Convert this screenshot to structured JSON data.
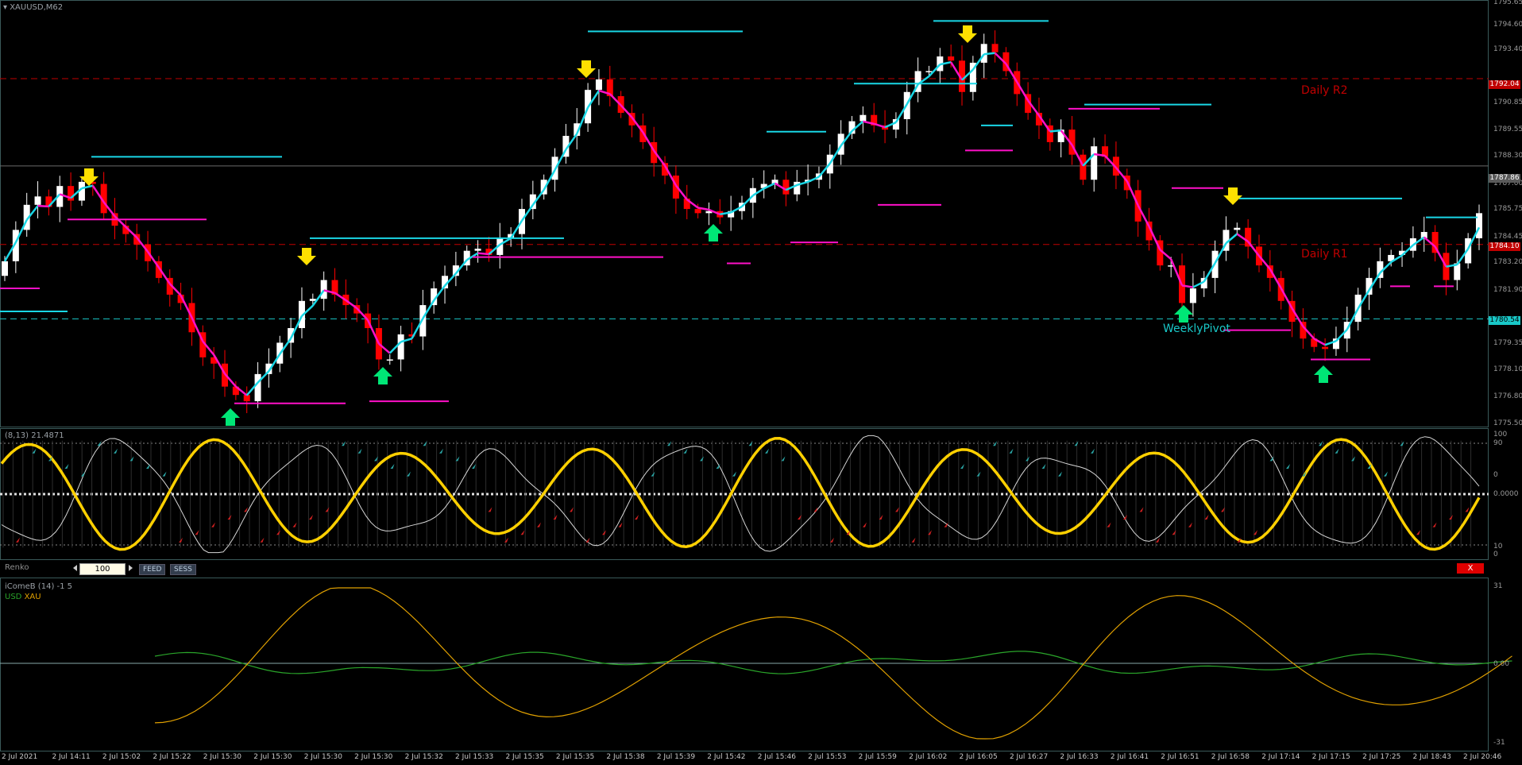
{
  "chart_window": {
    "symbol_label": "XAUUSD,M62",
    "stoch_label": "(8,13) 21.4871",
    "renko_panel": {
      "title": "Renko",
      "brick_value": "100",
      "feed_label": "FEED",
      "sess_label": "SESS",
      "close_label": "X"
    },
    "icome_label": "iComeB (14)  -1 5",
    "usd_label": "USD",
    "xau_label": "XAU",
    "colors": {
      "bull": "#ffffff",
      "bear": "#ff0000",
      "up_line": "#19d7e6",
      "down_line": "#ff10c8",
      "daily_level": "#c00000",
      "pivot": "#19c8c8",
      "stoch_main": "#ffd000",
      "usd_line": "#2aa52a",
      "xau_line": "#e0a000"
    }
  },
  "price_axis": [
    "1795.65",
    "1794.60",
    "1793.40",
    "1790.85",
    "1789.55",
    "1788.30",
    "1787.00",
    "1785.75",
    "1784.45",
    "1783.20",
    "1781.90",
    "1779.35",
    "1778.10",
    "1776.80",
    "1775.50"
  ],
  "price_badges": {
    "daily_r2": "1792.04",
    "current": "1787.86",
    "daily_r1": "1784.10",
    "pivot": "1780.54"
  },
  "level_labels": {
    "daily_r2": "Daily R2",
    "daily_r1": "Daily R1",
    "weekly_pivot": "WeeklyPivot"
  },
  "stoch_axis": [
    "100",
    "90",
    "0",
    "10",
    "0"
  ],
  "stoch_mid_label": "0.0000",
  "icome_axis": [
    "31",
    "0.00",
    "-31"
  ],
  "time_axis": [
    "2 Jul 2021",
    "2 Jul 14:11",
    "2 Jul 15:02",
    "2 Jul 15:22",
    "2 Jul 15:30",
    "2 Jul 15:30",
    "2 Jul 15:30",
    "2 Jul 15:30",
    "2 Jul 15:32",
    "2 Jul 15:33",
    "2 Jul 15:35",
    "2 Jul 15:35",
    "2 Jul 15:38",
    "2 Jul 15:39",
    "2 Jul 15:42",
    "2 Jul 15:46",
    "2 Jul 15:53",
    "2 Jul 15:59",
    "2 Jul 16:02",
    "2 Jul 16:05",
    "2 Jul 16:27",
    "2 Jul 16:33",
    "2 Jul 16:41",
    "2 Jul 16:51",
    "2 Jul 16:58",
    "2 Jul 17:14",
    "2 Jul 17:15",
    "2 Jul 17:25",
    "2 Jul 18:43",
    "2 Jul 20:46"
  ],
  "chart_data": {
    "type": "candlestick",
    "price_range": [
      1775.5,
      1795.65
    ],
    "closes": [
      1783.3,
      1784.8,
      1786.0,
      1786.4,
      1785.9,
      1786.9,
      1786.2,
      1787.1,
      1787.0,
      1785.6,
      1785.0,
      1784.6,
      1784.1,
      1783.3,
      1782.5,
      1781.7,
      1781.3,
      1779.9,
      1778.7,
      1778.4,
      1777.3,
      1776.9,
      1776.6,
      1777.9,
      1778.4,
      1779.4,
      1780.1,
      1781.4,
      1781.5,
      1782.4,
      1781.7,
      1781.2,
      1780.8,
      1780.1,
      1778.6,
      1778.6,
      1779.8,
      1779.7,
      1781.2,
      1782.0,
      1782.6,
      1783.1,
      1783.8,
      1783.9,
      1783.6,
      1784.4,
      1784.6,
      1785.8,
      1786.5,
      1787.2,
      1788.3,
      1789.3,
      1789.9,
      1791.5,
      1792.0,
      1791.2,
      1790.4,
      1789.8,
      1789.0,
      1788.0,
      1787.4,
      1786.3,
      1785.8,
      1785.6,
      1785.7,
      1785.4,
      1785.7,
      1786.1,
      1786.8,
      1787.0,
      1787.2,
      1786.5,
      1787.1,
      1787.2,
      1787.5,
      1788.4,
      1789.4,
      1790.0,
      1790.3,
      1789.8,
      1789.6,
      1790.1,
      1791.4,
      1792.4,
      1792.4,
      1793.1,
      1792.9,
      1791.4,
      1792.8,
      1793.7,
      1793.3,
      1792.4,
      1791.3,
      1790.4,
      1789.8,
      1789.0,
      1789.6,
      1788.4,
      1787.2,
      1788.8,
      1788.3,
      1787.4,
      1786.7,
      1785.2,
      1784.3,
      1783.1,
      1783.1,
      1781.3,
      1782.0,
      1782.5,
      1783.8,
      1784.8,
      1784.9,
      1784.0,
      1783.1,
      1782.5,
      1781.4,
      1780.4,
      1779.6,
      1779.2,
      1779.1,
      1779.6,
      1780.4,
      1781.7,
      1782.5,
      1783.3,
      1783.6,
      1783.8,
      1784.4,
      1784.7,
      1783.7,
      1782.4,
      1783.2,
      1784.4,
      1785.6
    ]
  }
}
